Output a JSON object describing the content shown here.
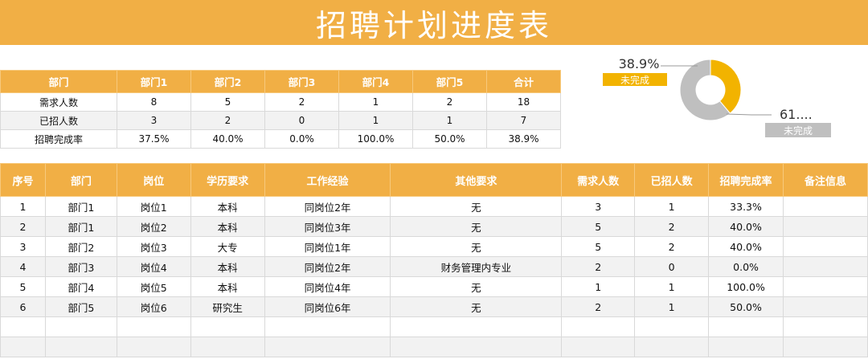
{
  "title": "招聘计划进度表",
  "summary": {
    "headers": [
      "部门",
      "部门1",
      "部门2",
      "部门3",
      "部门4",
      "部门5",
      "合计"
    ],
    "rows": [
      [
        "需求人数",
        "8",
        "5",
        "2",
        "1",
        "2",
        "18"
      ],
      [
        "已招人数",
        "3",
        "2",
        "0",
        "1",
        "1",
        "7"
      ],
      [
        "招聘完成率",
        "37.5%",
        "40.0%",
        "0.0%",
        "100.0%",
        "50.0%",
        "38.9%"
      ]
    ]
  },
  "chart_data": {
    "type": "pie",
    "variant": "donut",
    "slices": [
      {
        "label": "未完成",
        "value": 38.9,
        "value_label": "38.9%",
        "color": "#F2B300"
      },
      {
        "label": "未完成",
        "value": 61.1,
        "value_label": "61....",
        "color": "#BFBFBF"
      }
    ]
  },
  "detail": {
    "headers": [
      "序号",
      "部门",
      "岗位",
      "学历要求",
      "工作经验",
      "其他要求",
      "需求人数",
      "已招人数",
      "招聘完成率",
      "备注信息"
    ],
    "rows": [
      [
        "1",
        "部门1",
        "岗位1",
        "本科",
        "同岗位2年",
        "无",
        "3",
        "1",
        "33.3%",
        ""
      ],
      [
        "2",
        "部门1",
        "岗位2",
        "本科",
        "同岗位3年",
        "无",
        "5",
        "2",
        "40.0%",
        ""
      ],
      [
        "3",
        "部门2",
        "岗位3",
        "大专",
        "同岗位1年",
        "无",
        "5",
        "2",
        "40.0%",
        ""
      ],
      [
        "4",
        "部门3",
        "岗位4",
        "本科",
        "同岗位2年",
        "财务管理内专业",
        "2",
        "0",
        "0.0%",
        ""
      ],
      [
        "5",
        "部门4",
        "岗位5",
        "本科",
        "同岗位4年",
        "无",
        "1",
        "1",
        "100.0%",
        ""
      ],
      [
        "6",
        "部门5",
        "岗位6",
        "研究生",
        "同岗位6年",
        "无",
        "2",
        "1",
        "50.0%",
        ""
      ],
      [
        "",
        "",
        "",
        "",
        "",
        "",
        "",
        "",
        "",
        ""
      ],
      [
        "",
        "",
        "",
        "",
        "",
        "",
        "",
        "",
        "",
        ""
      ]
    ]
  }
}
